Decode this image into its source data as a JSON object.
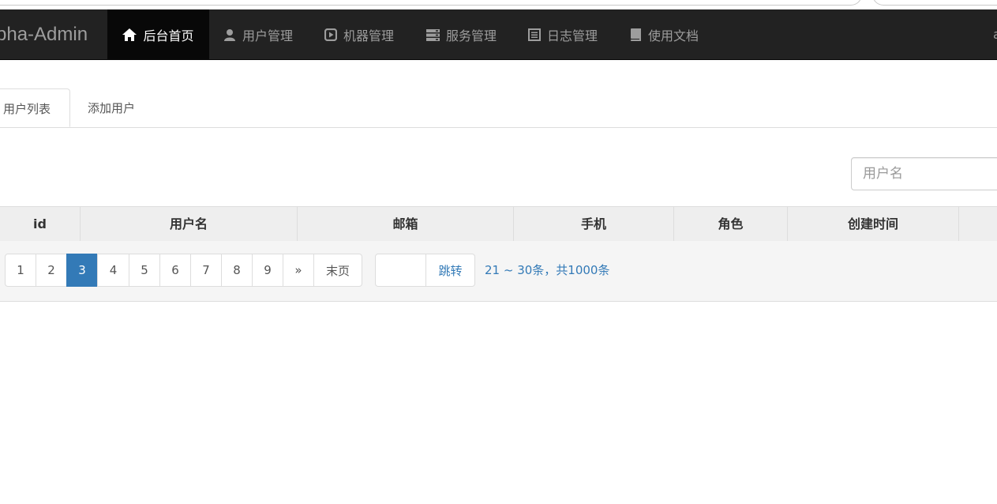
{
  "navbar": {
    "brand": "pha-Admin",
    "right_text": "a",
    "items": [
      {
        "label": "后台首页",
        "icon": "home-icon",
        "active": true
      },
      {
        "label": "用户管理",
        "icon": "user-icon",
        "active": false
      },
      {
        "label": "机器管理",
        "icon": "play-box-icon",
        "active": false
      },
      {
        "label": "服务管理",
        "icon": "server-icon",
        "active": false
      },
      {
        "label": "日志管理",
        "icon": "list-alt-icon",
        "active": false
      },
      {
        "label": "使用文档",
        "icon": "book-icon",
        "active": false
      }
    ]
  },
  "tabs": [
    {
      "label": "用户列表",
      "active": true
    },
    {
      "label": "添加用户",
      "active": false
    }
  ],
  "search": {
    "placeholder": "用户名",
    "value": ""
  },
  "table": {
    "columns": [
      "id",
      "用户名",
      "邮箱",
      "手机",
      "角色",
      "创建时间",
      ""
    ],
    "rows": []
  },
  "pagination": {
    "pages": [
      "1",
      "2",
      "3",
      "4",
      "5",
      "6",
      "7",
      "8",
      "9"
    ],
    "current": "3",
    "next_label": "»",
    "last_label": "末页",
    "jump_label": "跳转",
    "jump_value": "",
    "info": "21 ~ 30条，共1000条"
  },
  "colors": {
    "navbar_bg": "#222222",
    "active_bg": "#080808",
    "accent": "#337ab7"
  }
}
